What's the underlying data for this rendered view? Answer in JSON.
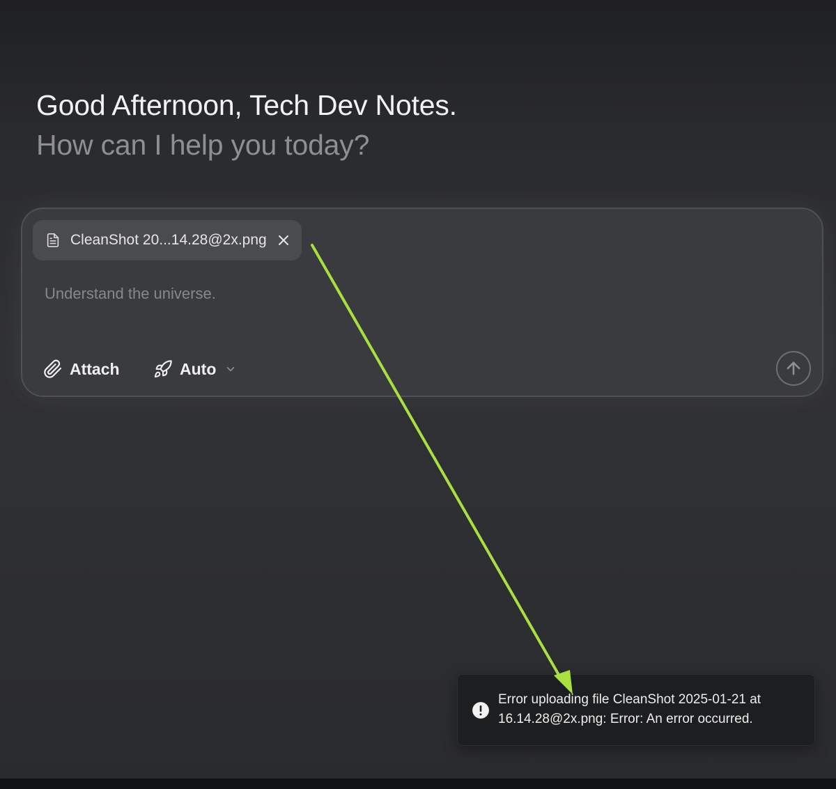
{
  "greeting": {
    "title": "Good Afternoon, Tech Dev Notes.",
    "subtitle": "How can I help you today?"
  },
  "composer": {
    "attachment": {
      "file_name": "CleanShot 20...14.28@2x.png",
      "icon": "document-icon",
      "remove_icon": "close-icon"
    },
    "input": {
      "value": "",
      "placeholder": "Understand the universe."
    },
    "toolbar": {
      "attach_label": "Attach",
      "attach_icon": "paperclip-icon",
      "mode_label": "Auto",
      "mode_icon": "rocket-icon",
      "mode_chevron_icon": "chevron-down-icon",
      "send_icon": "arrow-up-icon"
    }
  },
  "toast": {
    "icon": "exclamation-circle-icon",
    "message": "Error uploading file CleanShot 2025-01-21 at 16.14.28@2x.png: Error: An error occurred."
  },
  "colors": {
    "annotation_arrow": "#a8e040",
    "toast_background": "#1d1e20",
    "composer_background": "#3a3b3e"
  }
}
